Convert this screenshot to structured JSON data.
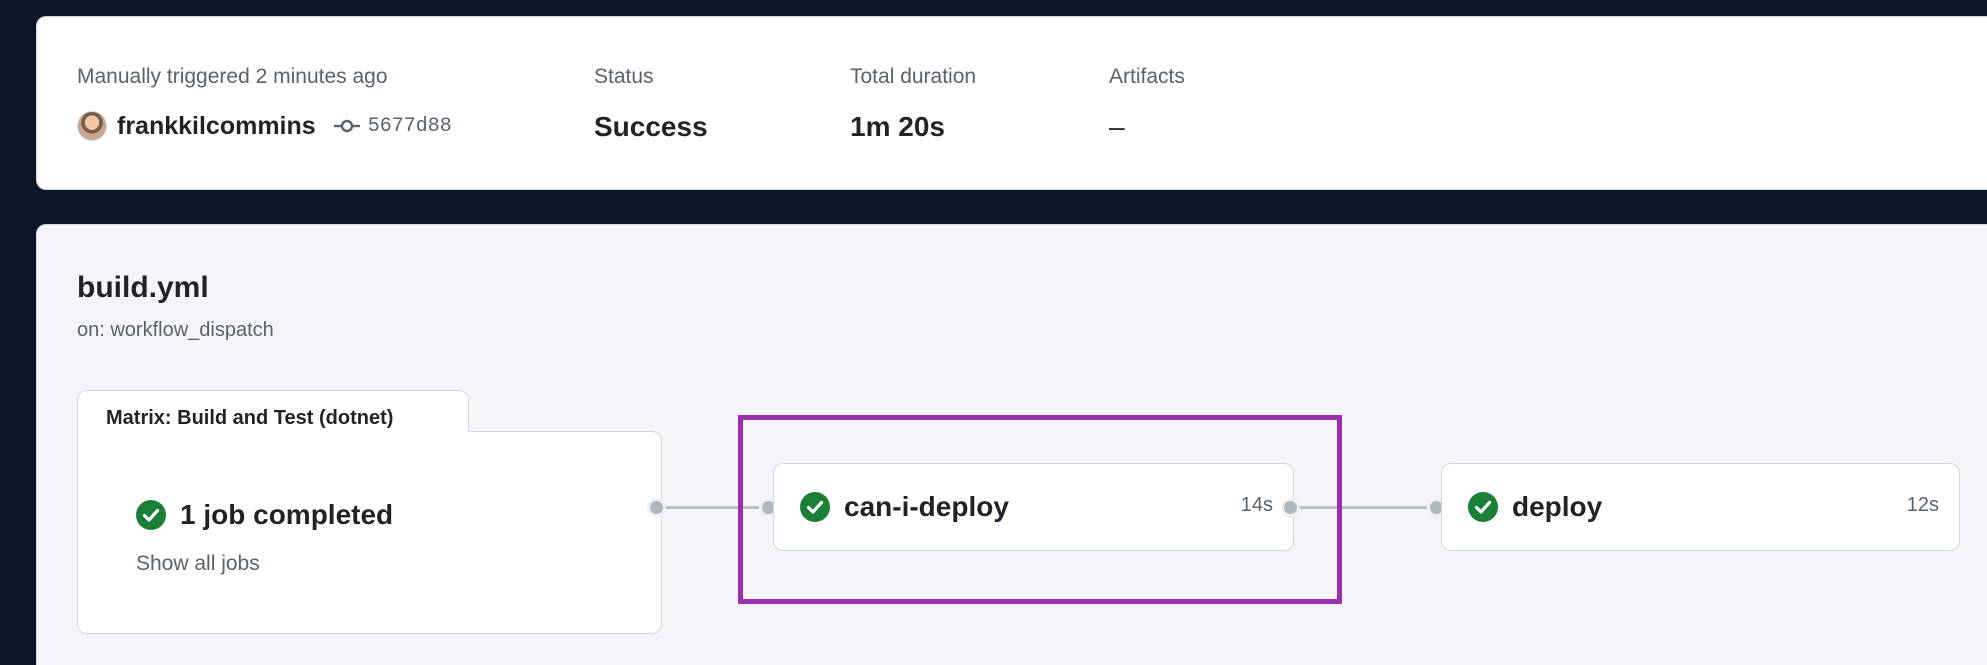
{
  "summary": {
    "trigger_label": "Manually triggered 2 minutes ago",
    "actor": "frankkilcommins",
    "commit_sha": "5677d88",
    "status_label": "Status",
    "status_value": "Success",
    "duration_label": "Total duration",
    "duration_value": "1m 20s",
    "artifacts_label": "Artifacts",
    "artifacts_value": "–"
  },
  "workflow": {
    "file": "build.yml",
    "trigger": "on: workflow_dispatch",
    "matrix": {
      "title": "Matrix: Build and Test (dotnet)",
      "status_text": "1 job completed",
      "show_all_label": "Show all jobs"
    },
    "jobs": [
      {
        "name": "can-i-deploy",
        "duration": "14s",
        "status": "success",
        "highlighted": true
      },
      {
        "name": "deploy",
        "duration": "12s",
        "status": "success",
        "highlighted": false
      }
    ]
  },
  "colors": {
    "success": "#1a7f37",
    "highlight": "#9b2fb0",
    "background": "#0d1628"
  },
  "icons": {
    "commit": "git-commit-icon",
    "success": "check-circle-fill-icon"
  }
}
